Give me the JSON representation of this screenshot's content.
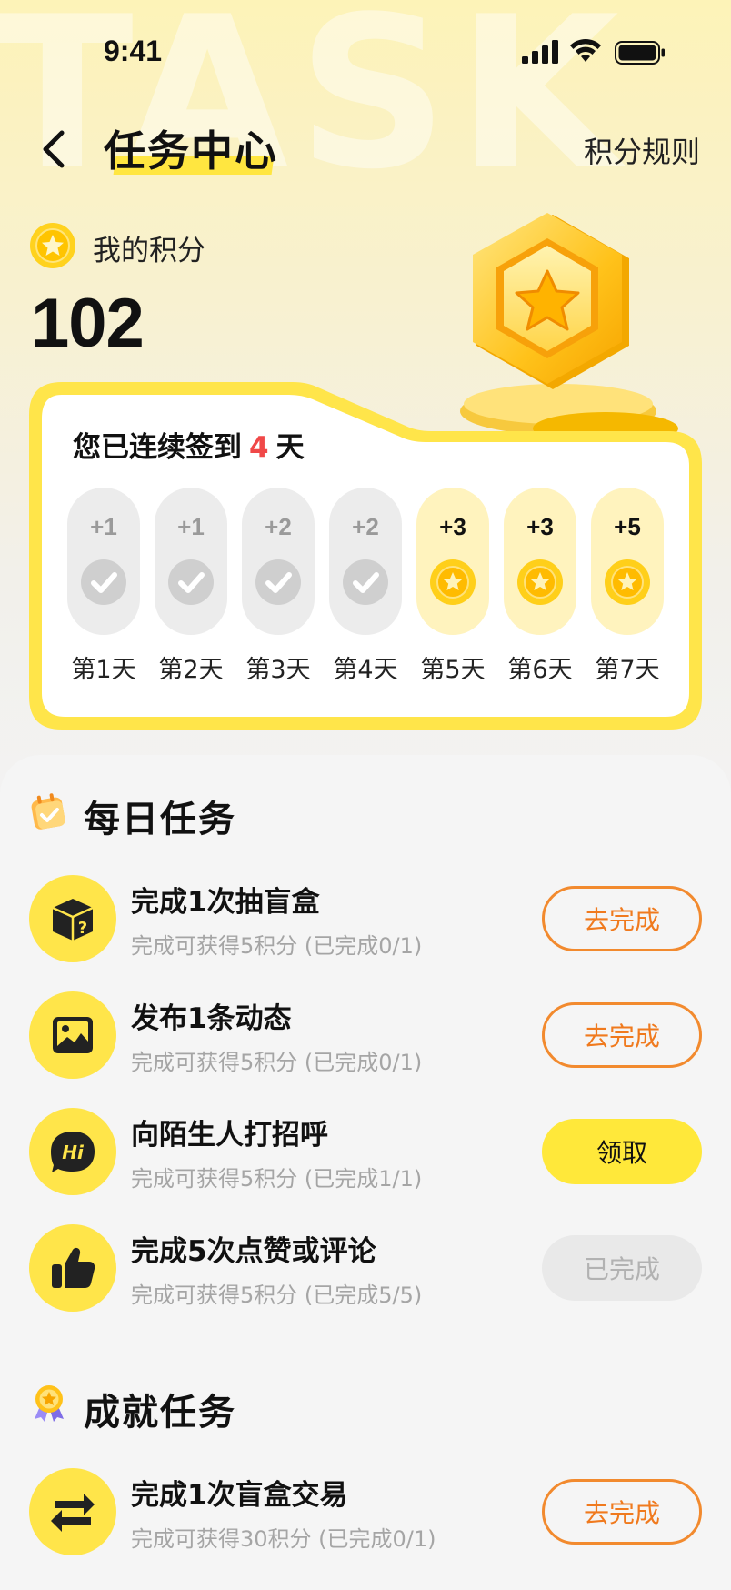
{
  "status_bar": {
    "time": "9:41"
  },
  "background_word": "TASK",
  "nav": {
    "title": "任务中心",
    "rules_label": "积分规则"
  },
  "points": {
    "label": "我的积分",
    "value": "102"
  },
  "checkin": {
    "prefix": "您已连续签到",
    "streak": "4",
    "suffix": "天",
    "days": [
      {
        "label": "第1天",
        "points": "+1",
        "state": "checked"
      },
      {
        "label": "第2天",
        "points": "+1",
        "state": "checked"
      },
      {
        "label": "第3天",
        "points": "+2",
        "state": "checked"
      },
      {
        "label": "第4天",
        "points": "+2",
        "state": "checked"
      },
      {
        "label": "第5天",
        "points": "+3",
        "state": "coin"
      },
      {
        "label": "第6天",
        "points": "+3",
        "state": "coin"
      },
      {
        "label": "第7天",
        "points": "+5",
        "state": "coin"
      }
    ]
  },
  "daily": {
    "title": "每日任务",
    "tasks": [
      {
        "name": "完成1次抽盲盒",
        "desc": "完成可获得5积分 (已完成0/1)",
        "button": "去完成",
        "button_state": "go",
        "icon": "mystery-box-icon"
      },
      {
        "name": "发布1条动态",
        "desc": "完成可获得5积分 (已完成0/1)",
        "button": "去完成",
        "button_state": "go",
        "icon": "image-icon"
      },
      {
        "name": "向陌生人打招呼",
        "desc": "完成可获得5积分 (已完成1/1)",
        "button": "领取",
        "button_state": "claim",
        "icon": "hi-chat-icon"
      },
      {
        "name": "完成5次点赞或评论",
        "desc": "完成可获得5积分 (已完成5/5)",
        "button": "已完成",
        "button_state": "done",
        "icon": "thumbs-up-icon"
      }
    ]
  },
  "achievement": {
    "title": "成就任务",
    "tasks": [
      {
        "name": "完成1次盲盒交易",
        "desc": "完成可获得30积分 (已完成0/1)",
        "button": "去完成",
        "button_state": "go",
        "icon": "exchange-icon"
      }
    ]
  },
  "colors": {
    "accent_yellow": "#ffe54a",
    "orange": "#f07a1e",
    "streak_red": "#f04848"
  }
}
